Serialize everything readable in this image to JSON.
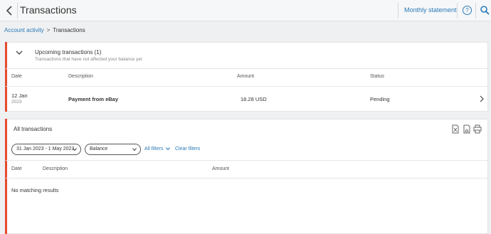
{
  "header": {
    "title": "Transactions",
    "monthly_statement": "Monthly statement",
    "help_glyph": "?",
    "icons": [
      "chevron-left-icon",
      "help-icon",
      "search-icon"
    ]
  },
  "breadcrumb": {
    "parent": "Account activity",
    "separator": ">",
    "current": "Transactions"
  },
  "upcoming": {
    "title": "Upcoming transactions (1)",
    "subtitle": "Transactions that have not affected your balance yet",
    "columns": [
      "Date",
      "Description",
      "Amount",
      "Status"
    ],
    "rows": [
      {
        "day": "12 Jan",
        "year": "2023",
        "description": "Payment from eBay",
        "amount": "18.28 USD",
        "status": "Pending"
      }
    ]
  },
  "all": {
    "title": "All transactions",
    "date_range": "31 Jan 2023 - 1 May 2023",
    "balance_select": "Balance",
    "all_filters": "All filters",
    "clear_filters": "Clear filters",
    "columns": [
      "Date",
      "Description",
      "Amount"
    ],
    "empty": "No matching results",
    "tool_icons": [
      "export-excel-icon",
      "export-pdf-icon",
      "print-icon"
    ]
  },
  "colors": {
    "accent": "#e54a2e",
    "link": "#2a7ab8",
    "background": "#eef0f2"
  }
}
